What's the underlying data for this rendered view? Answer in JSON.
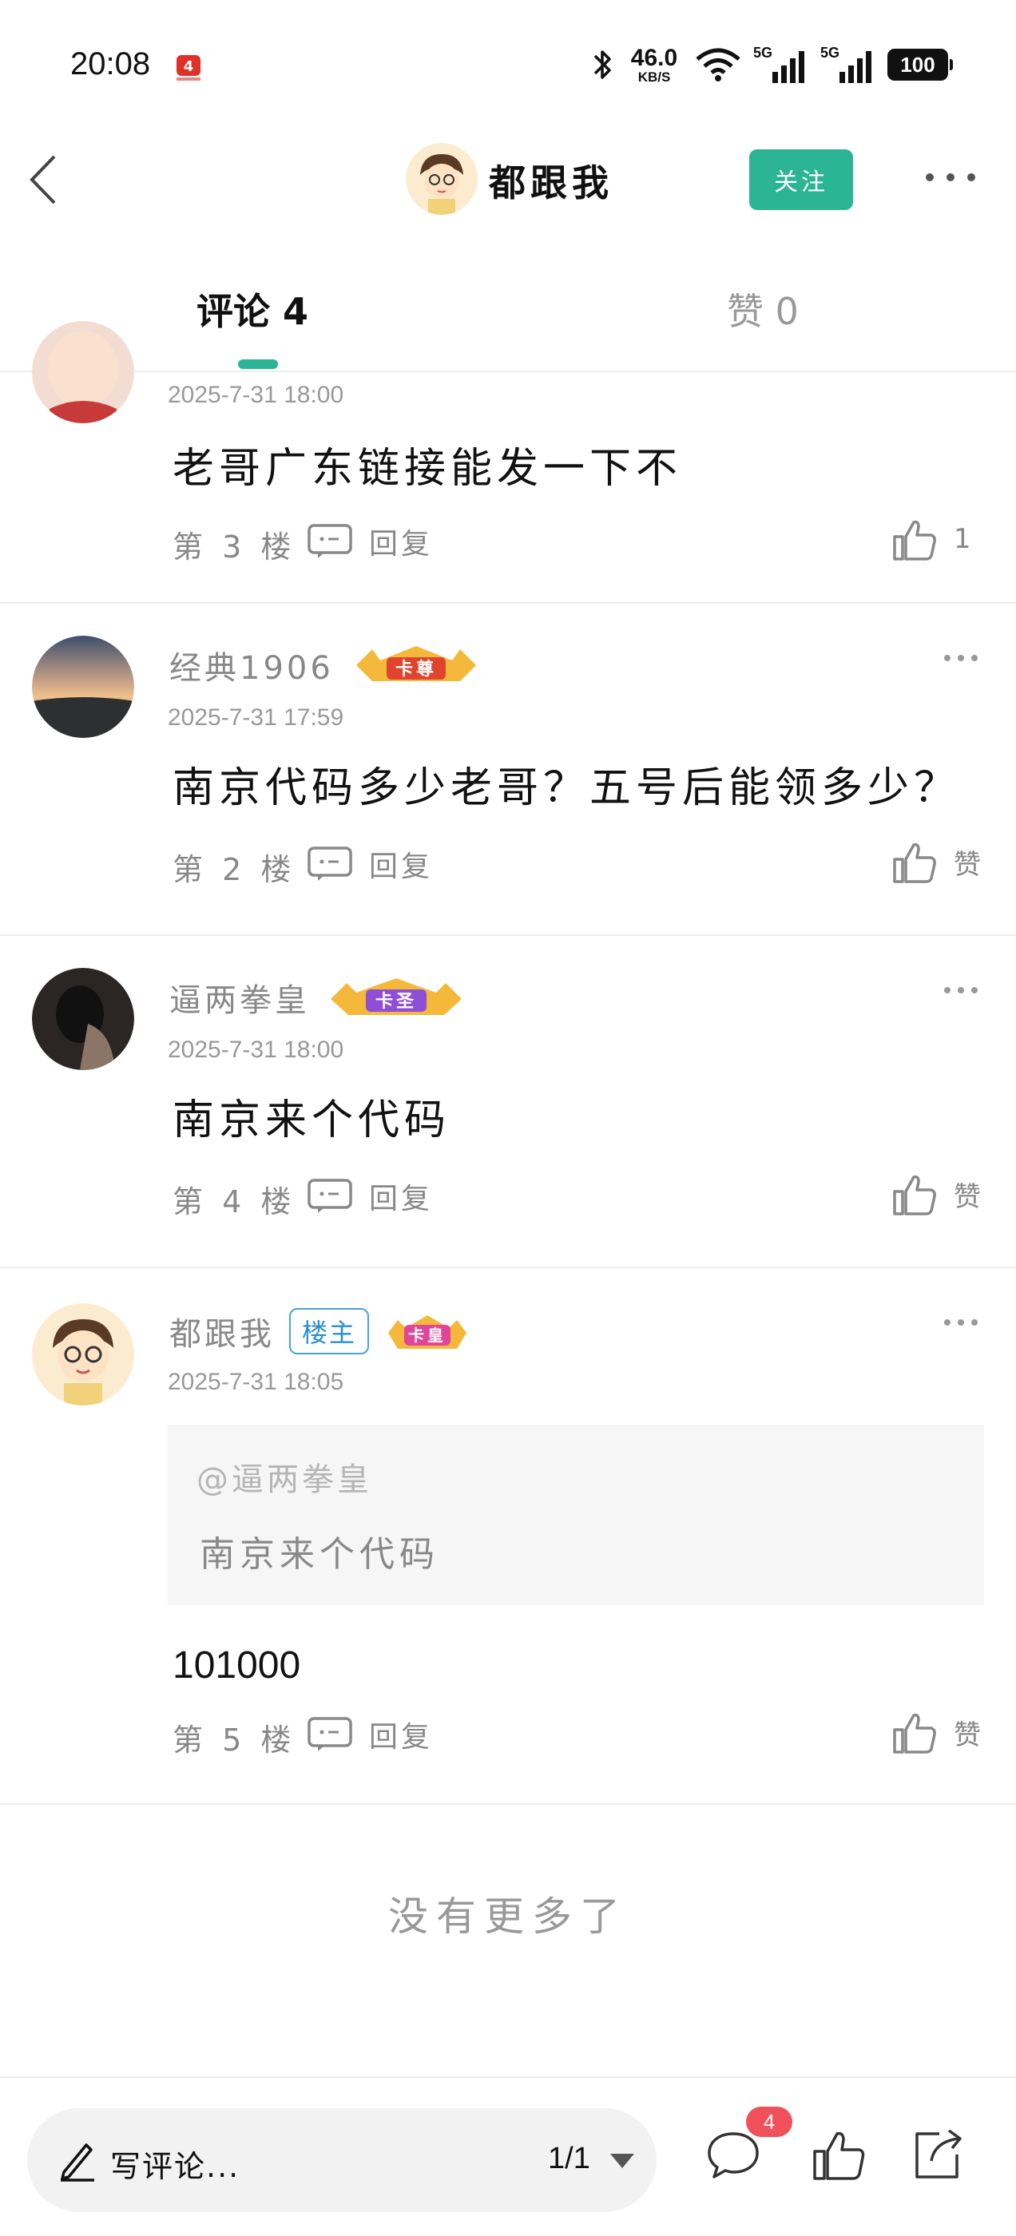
{
  "status_bar": {
    "time": "20:08",
    "net_speed": "46.0",
    "net_unit": "KB/S",
    "sim1": "5G",
    "sim2": "5G",
    "battery": "100",
    "icons": [
      "bluetooth-icon",
      "wifi-icon",
      "signal-icon",
      "battery-icon"
    ]
  },
  "header": {
    "user_name": "都跟我",
    "follow_label": "关注"
  },
  "tabs": [
    {
      "label": "评论 4",
      "active": true
    },
    {
      "label": "赞 0",
      "active": false
    }
  ],
  "comments": [
    {
      "time": "2025-7-31 18:00",
      "text": "老哥广东链接能发一下不",
      "floor": "第 3 楼",
      "reply_label": "回复",
      "like_label": "1"
    },
    {
      "user": "经典1906",
      "rank_badge": "卡尊",
      "time": "2025-7-31 17:59",
      "text": "南京代码多少老哥？五号后能领多少？",
      "floor": "第 2 楼",
      "reply_label": "回复",
      "like_label": "赞"
    },
    {
      "user": "逼两拳皇",
      "rank_badge": "卡圣",
      "time": "2025-7-31 18:00",
      "text": "南京来个代码",
      "floor": "第 4 楼",
      "reply_label": "回复",
      "like_label": "赞"
    },
    {
      "user": "都跟我",
      "owner_tag": "楼主",
      "rank_badge": "卡皇",
      "time": "2025-7-31 18:05",
      "quote_mention": "@逼两拳皇",
      "quote_text": "南京来个代码",
      "text": "101000",
      "floor": "第 5 楼",
      "reply_label": "回复",
      "like_label": "赞"
    }
  ],
  "no_more": "没有更多了",
  "bottom_bar": {
    "compose_placeholder": "写评论...",
    "page_indicator": "1/1",
    "comment_count": "4"
  },
  "colors": {
    "accent": "#2bb594",
    "badge_red": "#f0505a",
    "owner_tag": "#2a8fd0"
  }
}
